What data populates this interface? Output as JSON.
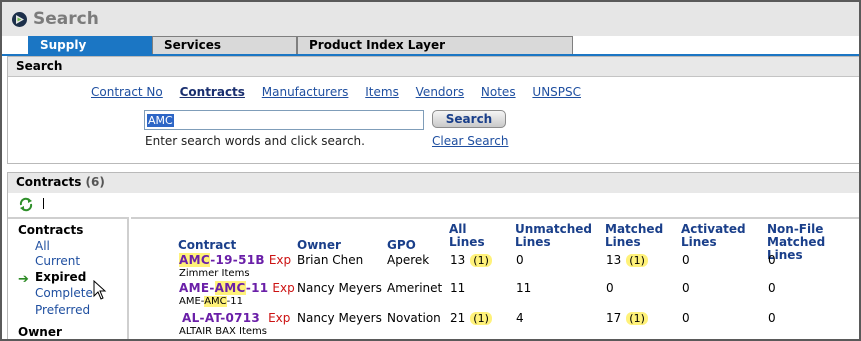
{
  "app": {
    "title": "Search"
  },
  "tabs": [
    {
      "label": "Supply"
    },
    {
      "label": "Services"
    },
    {
      "label": "Product Index Layer"
    }
  ],
  "search_panel": {
    "title": "Search",
    "links": [
      "Contract No",
      "Contracts",
      "Manufacturers",
      "Items",
      "Vendors",
      "Notes",
      "UNSPSC"
    ],
    "active_link": "Contracts",
    "input_value": "AMC",
    "button_label": "Search",
    "hint": "Enter search words and click search.",
    "clear_label": "Clear Search"
  },
  "contracts_panel": {
    "title": "Contracts",
    "count": "(6)",
    "toolbar_separator": "|"
  },
  "filters": {
    "title": "Contracts",
    "items": [
      "All",
      "Current",
      "Expired",
      "Complete",
      "Preferred"
    ],
    "active": "Expired",
    "owner_title": "Owner"
  },
  "table": {
    "columns": [
      "Contract",
      "Owner",
      "GPO",
      "All Lines",
      "Unmatched Lines",
      "Matched Lines",
      "Activated Lines",
      "Non-File Matched Lines"
    ],
    "rows": [
      {
        "contract": "AMC-19-51B",
        "highlight": "AMC",
        "status": "Exp",
        "subtitle": "Zimmer Items",
        "owner": "Brian Chen",
        "gpo": "Aperek",
        "all_lines": "13",
        "all_badge": "(1)",
        "unmatched": "0",
        "matched": "13",
        "matched_badge": "(1)",
        "activated": "0",
        "nonfile": "0"
      },
      {
        "contract": "AME-AMC-11",
        "highlight": "AMC",
        "status": "Exp",
        "subtitle": "AME-AMC-11",
        "owner": "Nancy Meyers",
        "gpo": "Amerinet",
        "all_lines": "11",
        "all_badge": "",
        "unmatched": "11",
        "matched": "0",
        "matched_badge": "",
        "activated": "0",
        "nonfile": "0"
      },
      {
        "contract": "AL-AT-0713",
        "highlight": "",
        "status": "Exp",
        "subtitle": "ALTAIR BAX Items",
        "owner": "Nancy Meyers",
        "gpo": "Novation",
        "all_lines": "21",
        "all_badge": "(1)",
        "unmatched": "4",
        "matched": "17",
        "matched_badge": "(1)",
        "activated": "0",
        "nonfile": "0"
      }
    ]
  },
  "icons": {
    "logo": "app-logo-icon",
    "refresh": "refresh-icon",
    "filter_arrow": "arrow-right-icon",
    "cursor": "mouse-cursor-icon"
  },
  "colors": {
    "tab_active": "#1b76c4",
    "link": "#1f4fa0",
    "contract_link": "#6a1fa8",
    "expired": "#cc1212",
    "highlight": "#fff27a"
  }
}
